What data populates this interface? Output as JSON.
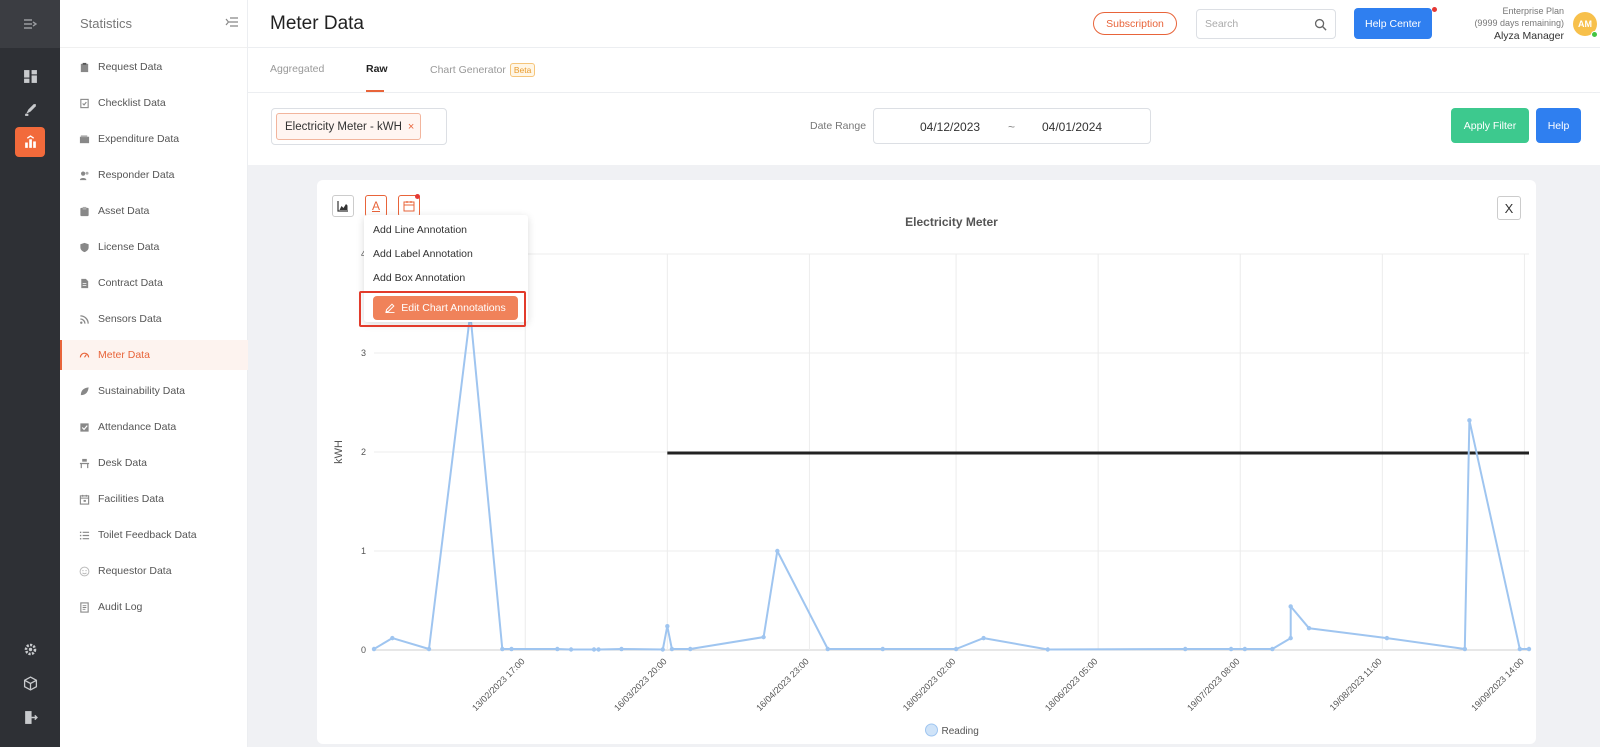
{
  "sidebar": {
    "title": "Statistics",
    "items": [
      {
        "label": "Request Data",
        "icon": "clipboard-icon"
      },
      {
        "label": "Checklist Data",
        "icon": "checklist-icon"
      },
      {
        "label": "Expenditure Data",
        "icon": "wallet-icon"
      },
      {
        "label": "Responder Data",
        "icon": "user-icon"
      },
      {
        "label": "Asset Data",
        "icon": "box-icon"
      },
      {
        "label": "License Data",
        "icon": "shield-icon"
      },
      {
        "label": "Contract Data",
        "icon": "document-icon"
      },
      {
        "label": "Sensors Data",
        "icon": "rss-icon"
      },
      {
        "label": "Meter Data",
        "icon": "gauge-icon",
        "active": true
      },
      {
        "label": "Sustainability Data",
        "icon": "leaf-icon"
      },
      {
        "label": "Attendance Data",
        "icon": "check-square-icon"
      },
      {
        "label": "Desk Data",
        "icon": "desk-icon"
      },
      {
        "label": "Facilities Data",
        "icon": "calendar-icon"
      },
      {
        "label": "Toilet Feedback Data",
        "icon": "list-icon"
      },
      {
        "label": "Requestor Data",
        "icon": "smiley-icon"
      },
      {
        "label": "Audit Log",
        "icon": "log-icon"
      }
    ]
  },
  "header": {
    "page_title": "Meter Data",
    "subscription_label": "Subscription",
    "search_placeholder": "Search",
    "help_center_label": "Help Center",
    "plan_name": "Enterprise Plan",
    "plan_remaining": "(9999 days remaining)",
    "user_name": "Alyza Manager",
    "avatar_initials": "AM"
  },
  "tabs": {
    "aggregated": "Aggregated",
    "raw": "Raw",
    "chart_generator": "Chart Generator",
    "beta": "Beta"
  },
  "filter": {
    "meter_chip": "Electricity Meter - kWH",
    "chip_remove": "×",
    "date_range_label": "Date Range",
    "date_from": "04/12/2023",
    "date_sep": "~",
    "date_to": "04/01/2024",
    "apply_label": "Apply Filter",
    "help_label": "Help"
  },
  "chart_toolbar": {
    "annotation_letter": "A",
    "close": "X"
  },
  "annotation_menu": {
    "add_line": "Add Line Annotation",
    "add_label": "Add Label Annotation",
    "add_box": "Add Box Annotation",
    "edit": "Edit Chart Annotations"
  },
  "colors": {
    "accent": "#e8643a",
    "series": "#9fc5f0",
    "annotation_line": "#222222",
    "apply": "#3dc98e",
    "help": "#2f7ff0"
  },
  "chart_data": {
    "type": "line",
    "title": "Electricity Meter",
    "ylabel": "kWH",
    "xlabel": "",
    "ylim": [
      0,
      4
    ],
    "yticks": [
      0,
      1,
      2,
      3,
      4
    ],
    "xticks": [
      "13/02/2023 17:00",
      "16/03/2023 20:00",
      "16/04/2023 23:00",
      "18/05/2023 02:00",
      "18/06/2023 05:00",
      "19/07/2023 08:00",
      "19/08/2023 11:00",
      "19/09/2023 14:00"
    ],
    "legend": "bottom",
    "grid": true,
    "series": [
      {
        "name": "Reading",
        "points": [
          {
            "x": "2023-01-11",
            "y": 0.01
          },
          {
            "x": "2023-01-15",
            "y": 0.12
          },
          {
            "x": "2023-01-23",
            "y": 0.01
          },
          {
            "x": "2023-02-01",
            "y": 3.4
          },
          {
            "x": "2023-02-08",
            "y": 0.01
          },
          {
            "x": "2023-02-10",
            "y": 0.01
          },
          {
            "x": "2023-02-20",
            "y": 0.01
          },
          {
            "x": "2023-02-23",
            "y": 0.005
          },
          {
            "x": "2023-02-28",
            "y": 0.005
          },
          {
            "x": "2023-03-01",
            "y": 0.005
          },
          {
            "x": "2023-03-06",
            "y": 0.01
          },
          {
            "x": "2023-03-15",
            "y": 0.005
          },
          {
            "x": "2023-03-16",
            "y": 0.24
          },
          {
            "x": "2023-03-17",
            "y": 0.01
          },
          {
            "x": "2023-03-21",
            "y": 0.01
          },
          {
            "x": "2023-04-06",
            "y": 0.13
          },
          {
            "x": "2023-04-09",
            "y": 1.0
          },
          {
            "x": "2023-04-20",
            "y": 0.01
          },
          {
            "x": "2023-05-02",
            "y": 0.01
          },
          {
            "x": "2023-05-18",
            "y": 0.01
          },
          {
            "x": "2023-05-24",
            "y": 0.12
          },
          {
            "x": "2023-06-07",
            "y": 0.005
          },
          {
            "x": "2023-07-07",
            "y": 0.01
          },
          {
            "x": "2023-07-17",
            "y": 0.01
          },
          {
            "x": "2023-07-20",
            "y": 0.01
          },
          {
            "x": "2023-07-26",
            "y": 0.01
          },
          {
            "x": "2023-07-30",
            "y": 0.12
          },
          {
            "x": "2023-07-30",
            "y": 0.44
          },
          {
            "x": "2023-08-03",
            "y": 0.22
          },
          {
            "x": "2023-08-20",
            "y": 0.12
          },
          {
            "x": "2023-09-06",
            "y": 0.01
          },
          {
            "x": "2023-09-07",
            "y": 2.32
          },
          {
            "x": "2023-09-18",
            "y": 0.01
          },
          {
            "x": "2023-09-20",
            "y": 0.01
          }
        ]
      }
    ],
    "annotations": [
      {
        "type": "line",
        "y": 1.99,
        "x_from": "2023-03-16",
        "x_to": "2023-09-20"
      }
    ]
  }
}
